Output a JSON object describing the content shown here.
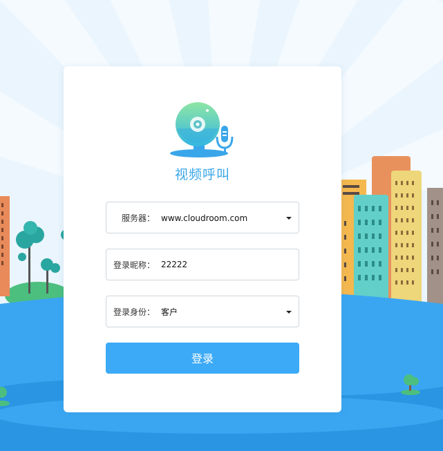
{
  "app": {
    "title": "视频呼叫"
  },
  "form": {
    "server_label": "服务器：",
    "server_value": "www.cloudroom.com",
    "nickname_label": "登录昵称：",
    "nickname_value": "22222",
    "role_label": "登录身份：",
    "role_value": "客户",
    "login_label": "登录"
  },
  "icons": {
    "logo": "webcam-microphone-icon",
    "dropdown": "chevron-down-icon"
  },
  "colors": {
    "accent": "#3daaf7",
    "title": "#3aa6ea",
    "water": "#3aa6f2",
    "sky": "#eaf5fd"
  }
}
